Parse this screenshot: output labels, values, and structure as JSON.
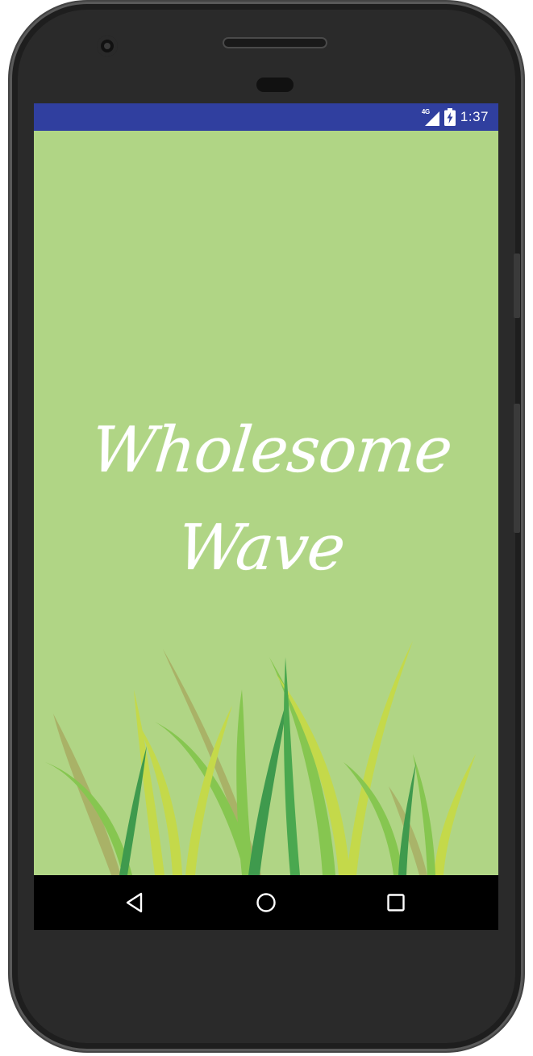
{
  "status_bar": {
    "network_label": "4G",
    "time": "1:37",
    "color": "#303f9f",
    "icons": [
      "signal-icon",
      "battery-charging-icon"
    ]
  },
  "splash": {
    "title": "Wholesome Wave",
    "background_color": "#b0d585",
    "text_color": "#ffffff",
    "decoration": "grass-illustration"
  },
  "nav_bar": {
    "buttons": [
      "back-icon",
      "home-icon",
      "recents-icon"
    ]
  }
}
